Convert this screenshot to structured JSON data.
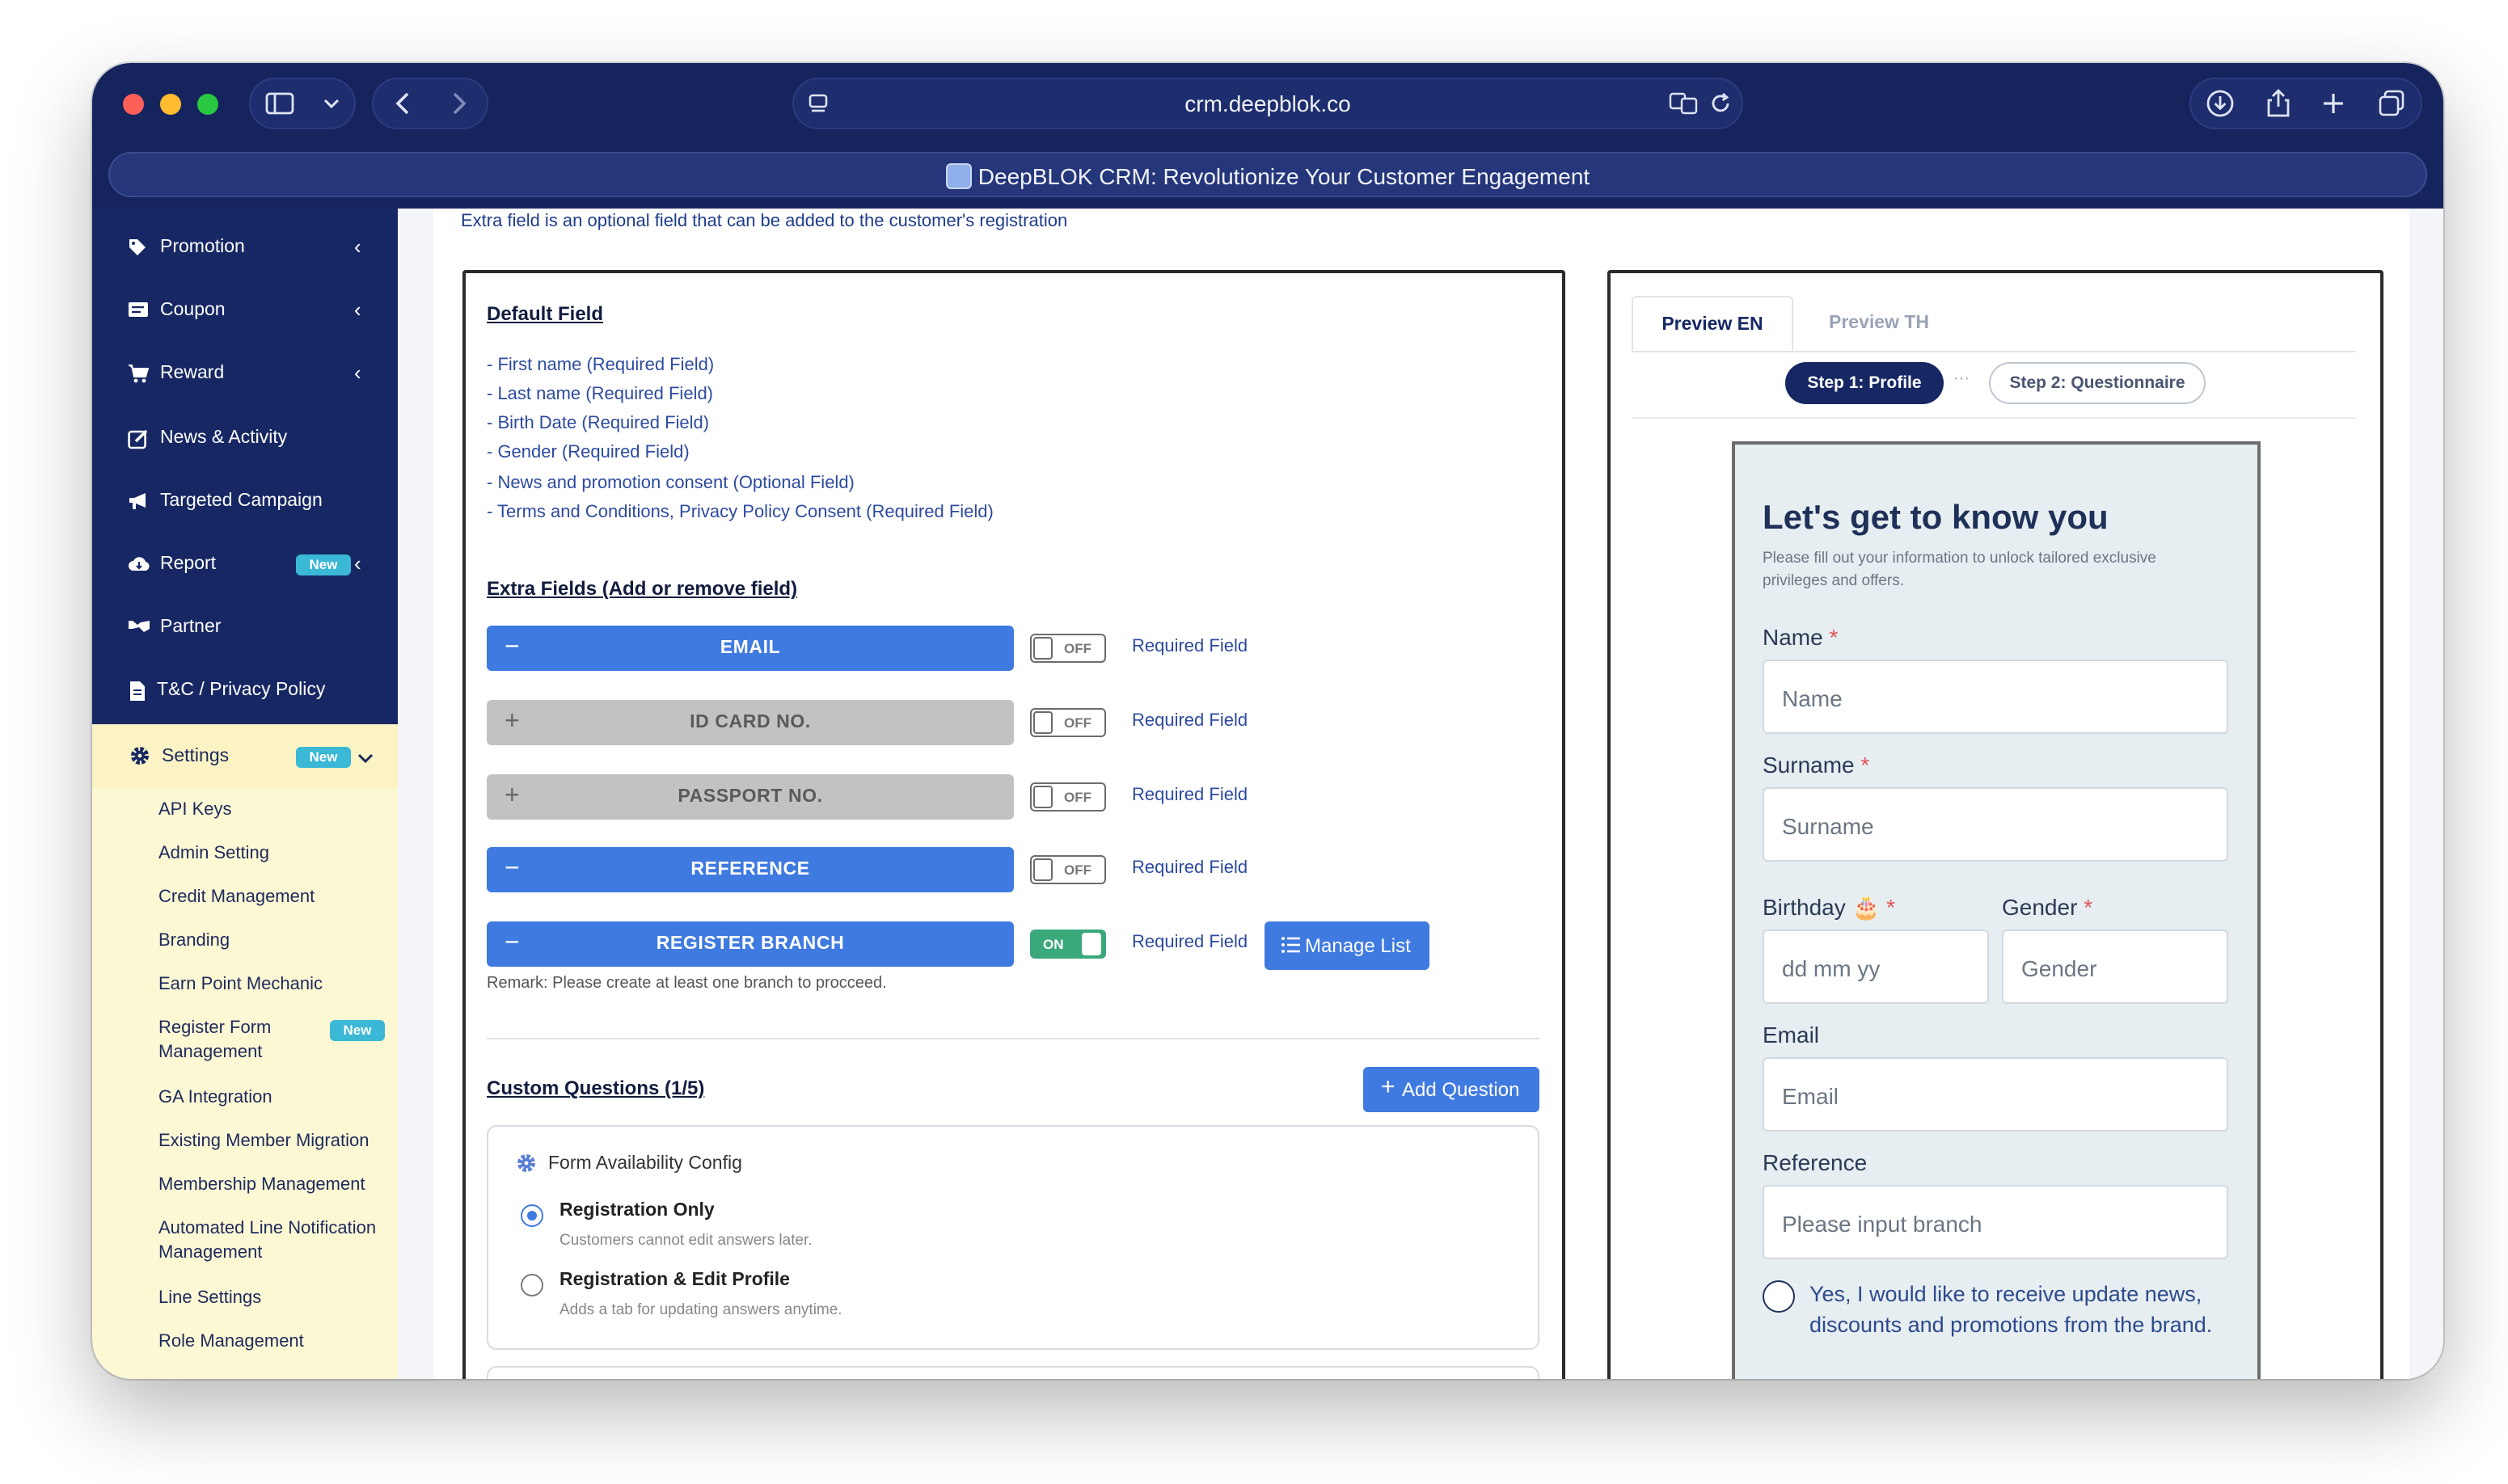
{
  "browser": {
    "url": "crm.deepblok.co",
    "tab_title": "DeepBLOK CRM: Revolutionize Your Customer Engagement"
  },
  "sidebar": {
    "items": [
      {
        "label": "Promotion",
        "icon": "tag-icon",
        "chevron": "‹"
      },
      {
        "label": "Coupon",
        "icon": "ticket-icon",
        "chevron": "‹"
      },
      {
        "label": "Reward",
        "icon": "cart-icon",
        "chevron": "‹"
      },
      {
        "label": "News & Activity",
        "icon": "edit-icon",
        "chevron": ""
      },
      {
        "label": "Targeted Campaign",
        "icon": "megaphone-icon",
        "chevron": ""
      },
      {
        "label": "Report",
        "icon": "cloud-download-icon",
        "badge": "New",
        "chevron": "‹"
      },
      {
        "label": "Partner",
        "icon": "handshake-icon",
        "chevron": ""
      },
      {
        "label": "T&C / Privacy Policy",
        "icon": "file-icon",
        "chevron": ""
      }
    ],
    "settings": {
      "label": "Settings",
      "badge": "New",
      "chevron": "⌄",
      "sub_items": [
        "API Keys",
        "Admin Setting",
        "Credit Management",
        "Branding",
        "Earn Point Mechanic",
        "Register Form Management",
        "GA Integration",
        "Existing Member Migration",
        "Membership Management",
        "Automated Line Notification Management",
        "Line Settings",
        "Role Management"
      ],
      "register_form_badge": "New"
    }
  },
  "main": {
    "intro": "Extra field is an optional field that can be added to the customer's registration",
    "default_field": {
      "title": "Default Field",
      "lines": [
        "- First name (Required Field)",
        "- Last name (Required Field)",
        "- Birth Date (Required Field)",
        "- Gender (Required Field)",
        "- News and promotion consent (Optional Field)",
        "- Terms and Conditions, Privacy Policy Consent (Required Field)"
      ]
    },
    "extra_fields": {
      "title": "Extra Fields (Add or remove field)",
      "fields": [
        {
          "label": "EMAIL",
          "symbol": "−",
          "enabled": true,
          "toggle": "OFF",
          "required_label": "Required Field"
        },
        {
          "label": "ID CARD NO.",
          "symbol": "+",
          "enabled": false,
          "toggle": "OFF",
          "required_label": "Required Field"
        },
        {
          "label": "PASSPORT NO.",
          "symbol": "+",
          "enabled": false,
          "toggle": "OFF",
          "required_label": "Required Field"
        },
        {
          "label": "REFERENCE",
          "symbol": "−",
          "enabled": true,
          "toggle": "OFF",
          "required_label": "Required Field"
        },
        {
          "label": "REGISTER BRANCH",
          "symbol": "−",
          "enabled": true,
          "toggle": "ON",
          "required_label": "Required Field"
        }
      ],
      "manage_list": "Manage List",
      "remark": "Remark: Please create at least one branch to procceed."
    },
    "custom_questions": {
      "title": "Custom Questions (1/5)",
      "add_button": "Add Question",
      "config_title": "Form Availability Config",
      "options": [
        {
          "label": "Registration Only",
          "desc": "Customers cannot edit answers later.",
          "selected": true
        },
        {
          "label": "Registration & Edit Profile",
          "desc": "Adds a tab for updating answers anytime.",
          "selected": false
        }
      ]
    }
  },
  "preview": {
    "tabs": [
      "Preview EN",
      "Preview TH"
    ],
    "steps": [
      "Step 1: Profile",
      "Step 2: Questionnaire"
    ],
    "step_separator": "···",
    "form": {
      "heading": "Let's get to know you",
      "subtitle": "Please fill out your information to unlock tailored exclusive privileges and offers.",
      "name_label": "Name",
      "name_placeholder": "Name",
      "surname_label": "Surname",
      "surname_placeholder": "Surname",
      "birthday_label": "Birthday 🎂",
      "birthday_placeholder": "dd mm yy",
      "gender_label": "Gender",
      "gender_placeholder": "Gender",
      "email_label": "Email",
      "email_placeholder": "Email",
      "reference_label": "Reference",
      "reference_placeholder": "Please input branch",
      "consent": "Yes, I would like to receive update news, discounts and promotions from the brand.",
      "required_mark": "*"
    }
  },
  "colors": {
    "sidebar_bg": "#162763",
    "accent_blue": "#3f7ae0",
    "toggle_on": "#3aa87a",
    "badge": "#3ab8d6"
  }
}
